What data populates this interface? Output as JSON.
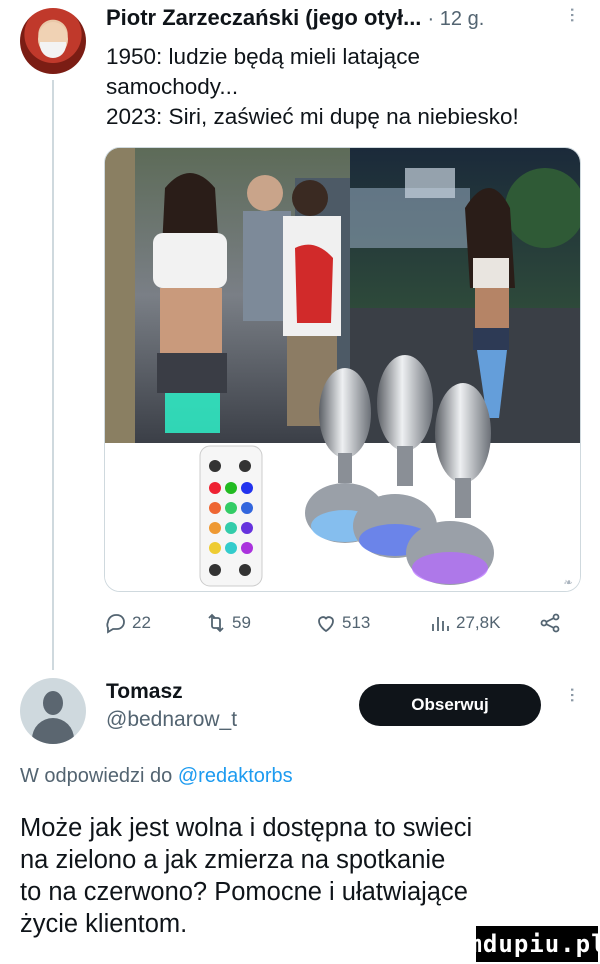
{
  "tweet": {
    "author_name": "Piotr Zarzeczański (jego otył...",
    "time": "· 12 g.",
    "text": "1950: ludzie będą mieli latające\nsamochody...\n2023: Siri, zaświeć mi dupę na niebiesko!",
    "metrics": {
      "replies": "22",
      "retweets": "59",
      "likes": "513",
      "views": "27,8K"
    },
    "icons": [
      "reply-icon",
      "retweet-icon",
      "heart-icon",
      "views-icon",
      "share-icon",
      "more-icon"
    ]
  },
  "reply": {
    "author_name": "Tomasz",
    "handle": "@bednarow_t",
    "follow_label": "Obserwuj",
    "reply_prefix": "W odpowiedzi do",
    "reply_mention": "@redaktorbs",
    "text": "Może jak jest wolna i dostępna to swieci\nna zielono a jak zmierza na spotkanie\nto na czerwono? Pomocne i ułatwiające\nżycie klientom."
  },
  "watermark": "mdupiu.pl",
  "colors": {
    "text": "#0f1419",
    "secondary": "#536471",
    "link": "#1d9bf0",
    "button": "#0f1419"
  }
}
